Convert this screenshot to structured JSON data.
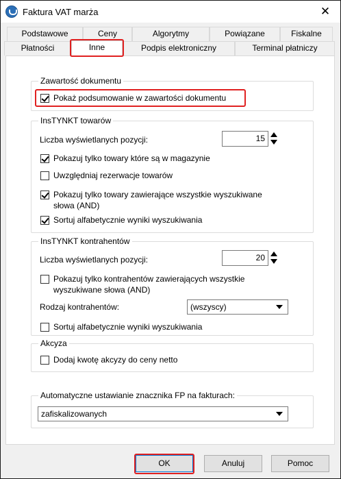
{
  "window": {
    "title": "Faktura VAT marża",
    "close_glyph": "✕"
  },
  "tabs_row1": [
    "Podstawowe",
    "Ceny",
    "Algorytmy",
    "Powiązane",
    "Fiskalne"
  ],
  "tabs_row2": [
    "Płatności",
    "Inne",
    "Podpis elektroniczny",
    "Terminal płatniczy"
  ],
  "active_tab": "Inne",
  "zawartosc": {
    "title": "Zawartość dokumentu",
    "show_summary": {
      "label": "Pokaż podsumowanie w zawartości dokumentu",
      "checked": true
    }
  },
  "instynkt_towary": {
    "title": "InsTYNKT towarów",
    "count_label": "Liczba wyświetlanych pozycji:",
    "count_value": "15",
    "opt_in_stock": {
      "label": "Pokazuj tylko towary które są w magazynie",
      "checked": true
    },
    "opt_reservations": {
      "label": "Uwzględniaj rezerwacje towarów",
      "checked": false
    },
    "opt_all_words": {
      "label1": "Pokazuj tylko towary zawierające wszystkie wyszukiwane",
      "label2": "słowa (AND)",
      "checked": true
    },
    "opt_sort": {
      "label": "Sortuj alfabetycznie wyniki wyszukiwania",
      "checked": true
    }
  },
  "instynkt_kontrahenci": {
    "title": "InsTYNKT kontrahentów",
    "count_label": "Liczba wyświetlanych pozycji:",
    "count_value": "20",
    "opt_all_words": {
      "label1": "Pokazuj tylko kontrahentów zawierających wszystkie",
      "label2": "wyszukiwane słowa (AND)",
      "checked": false
    },
    "type_label": "Rodzaj kontrahentów:",
    "type_value": "(wszyscy)",
    "opt_sort": {
      "label": "Sortuj alfabetycznie wyniki wyszukiwania",
      "checked": false
    }
  },
  "akcyza": {
    "title": "Akcyza",
    "opt_add": {
      "label": "Dodaj kwotę akcyzy do ceny netto",
      "checked": false
    }
  },
  "fp": {
    "title": "Automatyczne ustawianie znacznika FP na fakturach:",
    "value": "zafiskalizowanych"
  },
  "buttons": {
    "ok": "OK",
    "cancel": "Anuluj",
    "help": "Pomoc"
  },
  "colors": {
    "highlight": "#e02020",
    "accent": "#0078d7"
  }
}
